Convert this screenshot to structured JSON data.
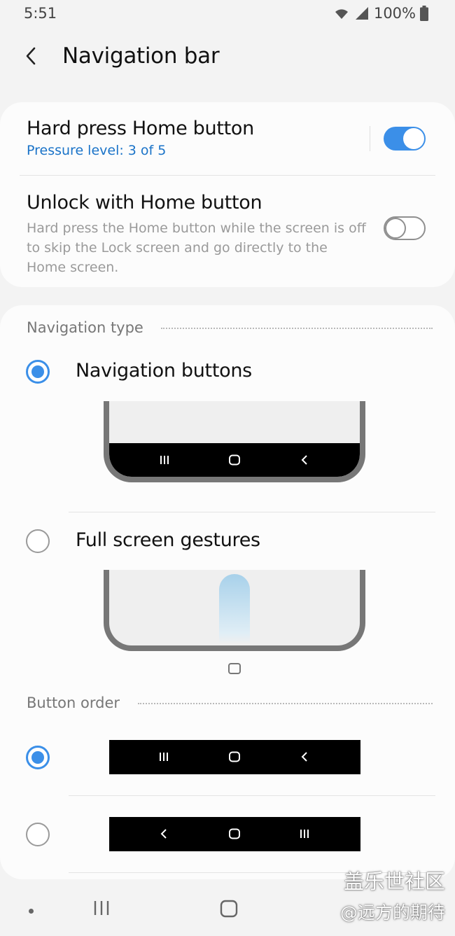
{
  "status": {
    "time": "5:51",
    "battery_text": "100%",
    "icons": [
      "wifi-icon",
      "signal-icon",
      "battery-icon"
    ]
  },
  "header": {
    "title": "Navigation bar",
    "back_icon": "back-arrow-icon"
  },
  "settings": [
    {
      "title": "Hard press Home button",
      "subtitle": "Pressure level: 3 of 5",
      "enabled": true
    },
    {
      "title": "Unlock with Home button",
      "description": "Hard press the Home button while the screen is off to skip the Lock screen and go directly to the Home screen.",
      "enabled": false
    }
  ],
  "navigation_type": {
    "header": "Navigation type",
    "selected": "Navigation buttons",
    "options": [
      {
        "label": "Navigation buttons",
        "selected": true
      },
      {
        "label": "Full screen gestures",
        "selected": false
      }
    ]
  },
  "button_order": {
    "header": "Button order",
    "options": [
      {
        "selected": true,
        "icons": [
          "recents-icon",
          "home-icon",
          "back-icon"
        ]
      },
      {
        "selected": false,
        "icons": [
          "back-icon",
          "home-icon",
          "recents-icon"
        ]
      }
    ]
  },
  "watermark": {
    "line1": "盖乐世社区",
    "line2": "@远方的期待"
  },
  "bottom_nav": {
    "icons": [
      "dot-icon",
      "recents-icon",
      "home-icon"
    ]
  },
  "colors": {
    "accent": "#3b8fe8",
    "subtitle_link": "#1a73c8",
    "background": "#f3f3f3",
    "card": "#fcfcfc"
  }
}
